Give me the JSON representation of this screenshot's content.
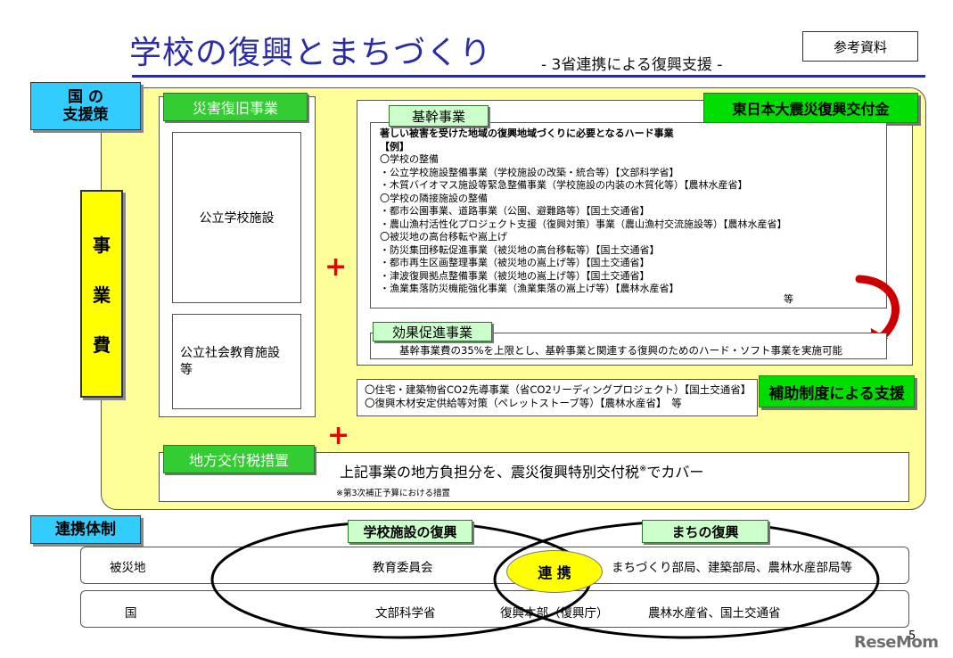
{
  "header": {
    "title": "学校の復興とまちづくり",
    "subtitle": "- 3省連携による復興支援 -",
    "reference": "参考資料"
  },
  "support": {
    "label": "国 の\n支援策",
    "label_line1": "国 の",
    "label_line2": "支援策",
    "cost_chars": [
      "事",
      "業",
      "費"
    ],
    "disaster_tag": "災害復旧事業",
    "public_school": "公立学校施設",
    "social_edu_line1": "公立社会教育施設",
    "social_edu_line2": "等",
    "grant_tag": "東日本大震災復興交付金",
    "core_tag": "基幹事業",
    "core_items": [
      "著しい被害を受けた地域の復興地域づくりに必要となるハード事業",
      "【例】",
      "〇学校の整備",
      "・公立学校施設整備事業（学校施設の改築・統合等）【文部科学省】",
      "・木質バイオマス施設等緊急整備事業（学校施設の内装の木質化等）【農林水産省】",
      "〇学校の隣接施設の整備",
      "・都市公園事業、道路事業（公園、避難路等）【国土交通省】",
      "・農山漁村活性化プロジェクト支援（復興対策）事業（農山漁村交流施設等）【農林水産省】",
      "〇被災地の高台移転や嵩上げ",
      "・防災集団移転促進事業（被災地の高台移転等）【国土交通省】",
      "・都市再生区画整理事業（被災地の嵩上げ等）【国土交通省】",
      "・津波復興拠点整備事業（被災地の嵩上げ等）【国土交通省】",
      "・漁業集落防災機能強化事業（漁業集落の嵩上げ等）【農林水産省】"
    ],
    "core_etc": "等",
    "effect_tag": "効果促進事業",
    "effect_text": "基幹事業費の35%を上限とし、基幹事業と関連する復興のためのハード・ソフト事業を実施可能",
    "subsidy_items": [
      "〇住宅・建築物省CO2先導事業（省CO2リーディングプロジェクト）【国土交通省】",
      "〇復興木材安定供給等対策（ペレットストーブ等）【農林水産省】　等"
    ],
    "subsidy_tag": "補助制度による支援",
    "plus": "+",
    "tax_tag": "地方交付税措置",
    "tax_text_main": "上記事業の地方負担分を、震災復興特別交付税",
    "tax_text_mark": "※",
    "tax_text_end": "でカバー",
    "tax_note": "※第3次補正予算における措置"
  },
  "cooperation": {
    "label": "連携体制",
    "school_tag": "学校施設の復興",
    "town_tag": "まちの復興",
    "row1_label": "被災地",
    "row1_left": "教育委員会",
    "row1_right": "まちづくり部局、建築部局、農林水産部局等",
    "center": "連 携",
    "row2_label": "国",
    "row2_left": "文部科学省",
    "row2_mid": "復興本部（復興庁）",
    "row2_right": "農林水産省、国土交通省"
  },
  "footer": {
    "page": "5",
    "watermark": "ReseMom"
  },
  "colors": {
    "title_blue": "#2b2ba8",
    "panel_yellow": "#ffff99",
    "cyan": "#33ccff",
    "green": "#33cc33",
    "plus_red": "#e00000",
    "ellipse_fill": "#ffff00"
  }
}
